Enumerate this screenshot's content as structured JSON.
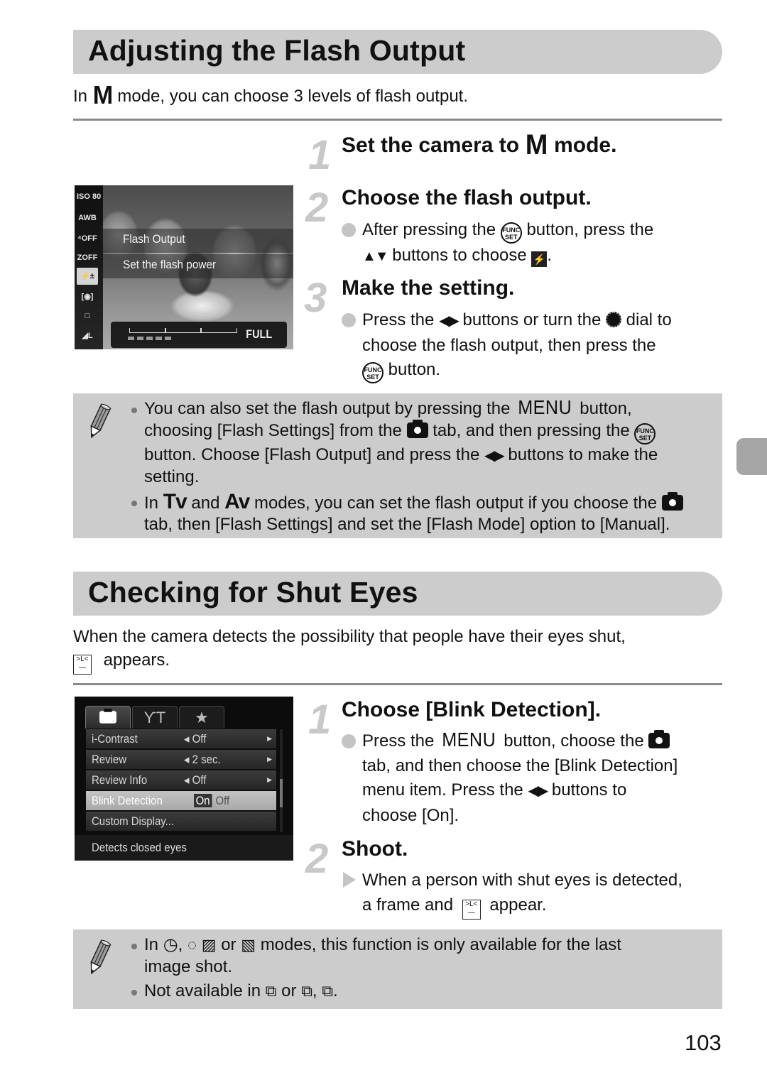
{
  "section1": {
    "title": "Adjusting the Flash Output",
    "intro_pre": "In",
    "intro_mode": "M",
    "intro_post": "mode, you can choose 3 levels of flash output.",
    "steps": [
      {
        "num": "1",
        "title_pre": "Set the camera to",
        "title_mode": "M",
        "title_post": "mode."
      },
      {
        "num": "2",
        "title": "Choose the flash output.",
        "bullet_line1_pre": "After pressing the",
        "bullet_line1_icon": "func-set-button-icon",
        "bullet_line1_post": "button, press the",
        "bullet_line2_arrows": "▲▼",
        "bullet_line2_text": "buttons to choose",
        "bullet_line2_icon": "flash-exposure-icon",
        "bullet_line2_end": "."
      },
      {
        "num": "3",
        "title": "Make the setting.",
        "bullet_line1_pre": "Press the",
        "bullet_line1_arrows": "◀▶",
        "bullet_line1_mid": "buttons or turn the",
        "bullet_line1_post": "dial to",
        "bullet_line2": "choose the flash output, then press the",
        "bullet_line3": "button."
      }
    ],
    "lcd": {
      "side_icons": [
        "ISO 80",
        "AWB",
        "⁴OFF",
        "ZOFF",
        "⚡±",
        "[◉]",
        "□",
        "◢L"
      ],
      "selected_icon_index": 4,
      "caption_title": "Flash Output",
      "caption_sub": "Set the flash power",
      "level_label": "FULL",
      "level_steps": 3,
      "level_value": "FULL"
    },
    "note": {
      "items": [
        {
          "l1_pre": "You can also set the flash output by pressing the",
          "l1_menu": "MENU",
          "l1_post": "button,",
          "l2_pre": "choosing [Flash Settings] from the",
          "l2_post": "tab, and then pressing the",
          "l3_pre": "button. Choose [Flash Output] and press the",
          "l3_arrows": "◀▶",
          "l3_post": "buttons to make the",
          "l4": "setting."
        },
        {
          "l1_pre": "In",
          "l1_tv": "Tv",
          "l1_and": "and",
          "l1_av": "Av",
          "l1_post": "modes, you can set the flash output if you choose the",
          "l2": "tab, then [Flash Settings] and set the [Flash Mode] option to [Manual]."
        }
      ]
    }
  },
  "section2": {
    "title": "Checking for Shut Eyes",
    "intro_line1": "When the camera detects the possibility that people have their eyes shut,",
    "intro_line2": "appears.",
    "steps": [
      {
        "num": "1",
        "title": "Choose [Blink Detection].",
        "l1_pre": "Press the",
        "l1_menu": "MENU",
        "l1_post": "button, choose the",
        "l2": "tab, and then choose the [Blink Detection]",
        "l3_pre": "menu item. Press the",
        "l3_arrows": "◀▶",
        "l3_post": "buttons to",
        "l4": "choose [On]."
      },
      {
        "num": "2",
        "title": "Shoot.",
        "l1": "When a person with shut eyes is detected,",
        "l2_pre": "a frame and",
        "l2_post": "appear."
      }
    ],
    "lcd": {
      "tabs": [
        "📷",
        "ƳT",
        "★"
      ],
      "active_tab_index": 0,
      "rows": [
        {
          "label": "i-Contrast",
          "value": "Off",
          "has_arrows": true
        },
        {
          "label": "Review",
          "value": "2 sec.",
          "has_arrows": true
        },
        {
          "label": "Review Info",
          "value": "Off",
          "has_arrows": true
        },
        {
          "label": "Blink Detection",
          "value_on": "On",
          "value_off": "Off",
          "selected": true
        },
        {
          "label": "Custom Display...",
          "value": ""
        }
      ],
      "help_text": "Detects closed eyes"
    },
    "note": {
      "l1_pre": "In",
      "l1_sep1": ",",
      "l1_or": "or",
      "l1_post": "modes, this function is only available for the last",
      "l2": "image shot.",
      "l3_pre": "Not available in",
      "l3_or": "or",
      "l3_sep": ",",
      "l3_end": "."
    }
  },
  "page_number": "103"
}
